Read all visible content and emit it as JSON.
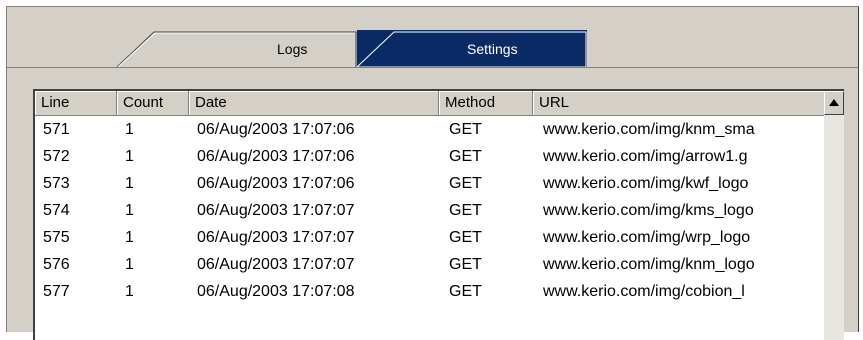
{
  "tabs": {
    "logs": "Logs",
    "settings": "Settings"
  },
  "columns": {
    "line": "Line",
    "count": "Count",
    "date": "Date",
    "method": "Method",
    "url": "URL"
  },
  "rows": [
    {
      "line": "571",
      "count": "1",
      "date": "06/Aug/2003 17:07:06",
      "method": "GET",
      "url": "www.kerio.com/img/knm_sma"
    },
    {
      "line": "572",
      "count": "1",
      "date": "06/Aug/2003 17:07:06",
      "method": "GET",
      "url": "www.kerio.com/img/arrow1.g"
    },
    {
      "line": "573",
      "count": "1",
      "date": "06/Aug/2003 17:07:06",
      "method": "GET",
      "url": "www.kerio.com/img/kwf_logo"
    },
    {
      "line": "574",
      "count": "1",
      "date": "06/Aug/2003 17:07:07",
      "method": "GET",
      "url": "www.kerio.com/img/kms_logo"
    },
    {
      "line": "575",
      "count": "1",
      "date": "06/Aug/2003 17:07:07",
      "method": "GET",
      "url": "www.kerio.com/img/wrp_logo"
    },
    {
      "line": "576",
      "count": "1",
      "date": "06/Aug/2003 17:07:07",
      "method": "GET",
      "url": "www.kerio.com/img/knm_logo"
    },
    {
      "line": "577",
      "count": "1",
      "date": "06/Aug/2003 17:07:08",
      "method": "GET",
      "url": "www.kerio.com/img/cobion_l"
    }
  ],
  "scrollbar": {
    "up_icon": "triangle-up-icon"
  },
  "colors": {
    "panel": "#d4d0c8",
    "active_tab_bg": "#0a2a66",
    "active_tab_text": "#ffffff"
  }
}
